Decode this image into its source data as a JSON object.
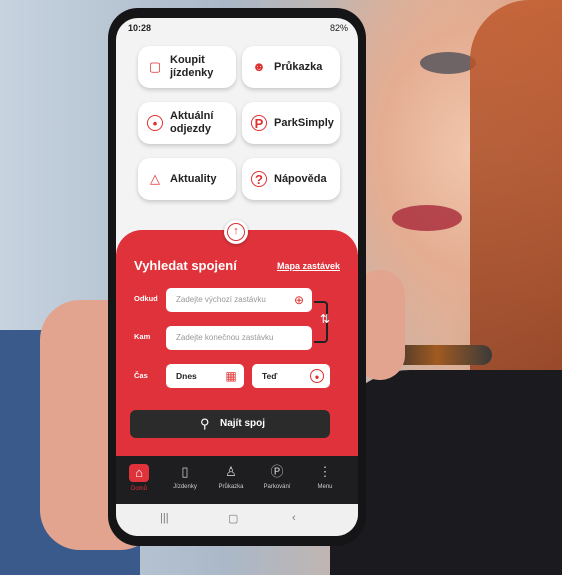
{
  "status": {
    "time": "10:28",
    "right": "82%"
  },
  "tiles": [
    {
      "label": "Koupit jízdenky",
      "icon": "bookmark-icon",
      "glyph": "🔖"
    },
    {
      "label": "Průkazka",
      "icon": "person-icon",
      "glyph": "👤"
    },
    {
      "label": "Aktuální odjezdy",
      "icon": "clock-icon",
      "glyph": "🕒"
    },
    {
      "label": "ParkSimply",
      "icon": "parking-icon",
      "glyph": "P"
    },
    {
      "label": "Aktuality",
      "icon": "bell-icon",
      "glyph": "🔔"
    },
    {
      "label": "Nápověda",
      "icon": "help-icon",
      "glyph": "?"
    }
  ],
  "search": {
    "title": "Vyhledat spojení",
    "map_link": "Mapa zastávek",
    "from_label": "Odkud",
    "from_placeholder": "Zadejte výchozí zastávku",
    "to_label": "Kam",
    "to_placeholder": "Zadejte konečnou zastávku",
    "time_label": "Čas",
    "date_value": "Dnes",
    "time_value": "Teď",
    "find_label": "Najít spoj"
  },
  "nav": [
    {
      "label": "Domů",
      "icon": "home-icon",
      "glyph": "⌂"
    },
    {
      "label": "Jízdenky",
      "icon": "ticket-icon",
      "glyph": "▯"
    },
    {
      "label": "Průkazka",
      "icon": "person-icon",
      "glyph": "♙"
    },
    {
      "label": "Parkování",
      "icon": "parking-icon",
      "glyph": "Ⓟ"
    },
    {
      "label": "Menu",
      "icon": "menu-dots-icon",
      "glyph": "⋮"
    }
  ],
  "colors": {
    "accent": "#e0323a",
    "dark": "#2b2b2b"
  }
}
